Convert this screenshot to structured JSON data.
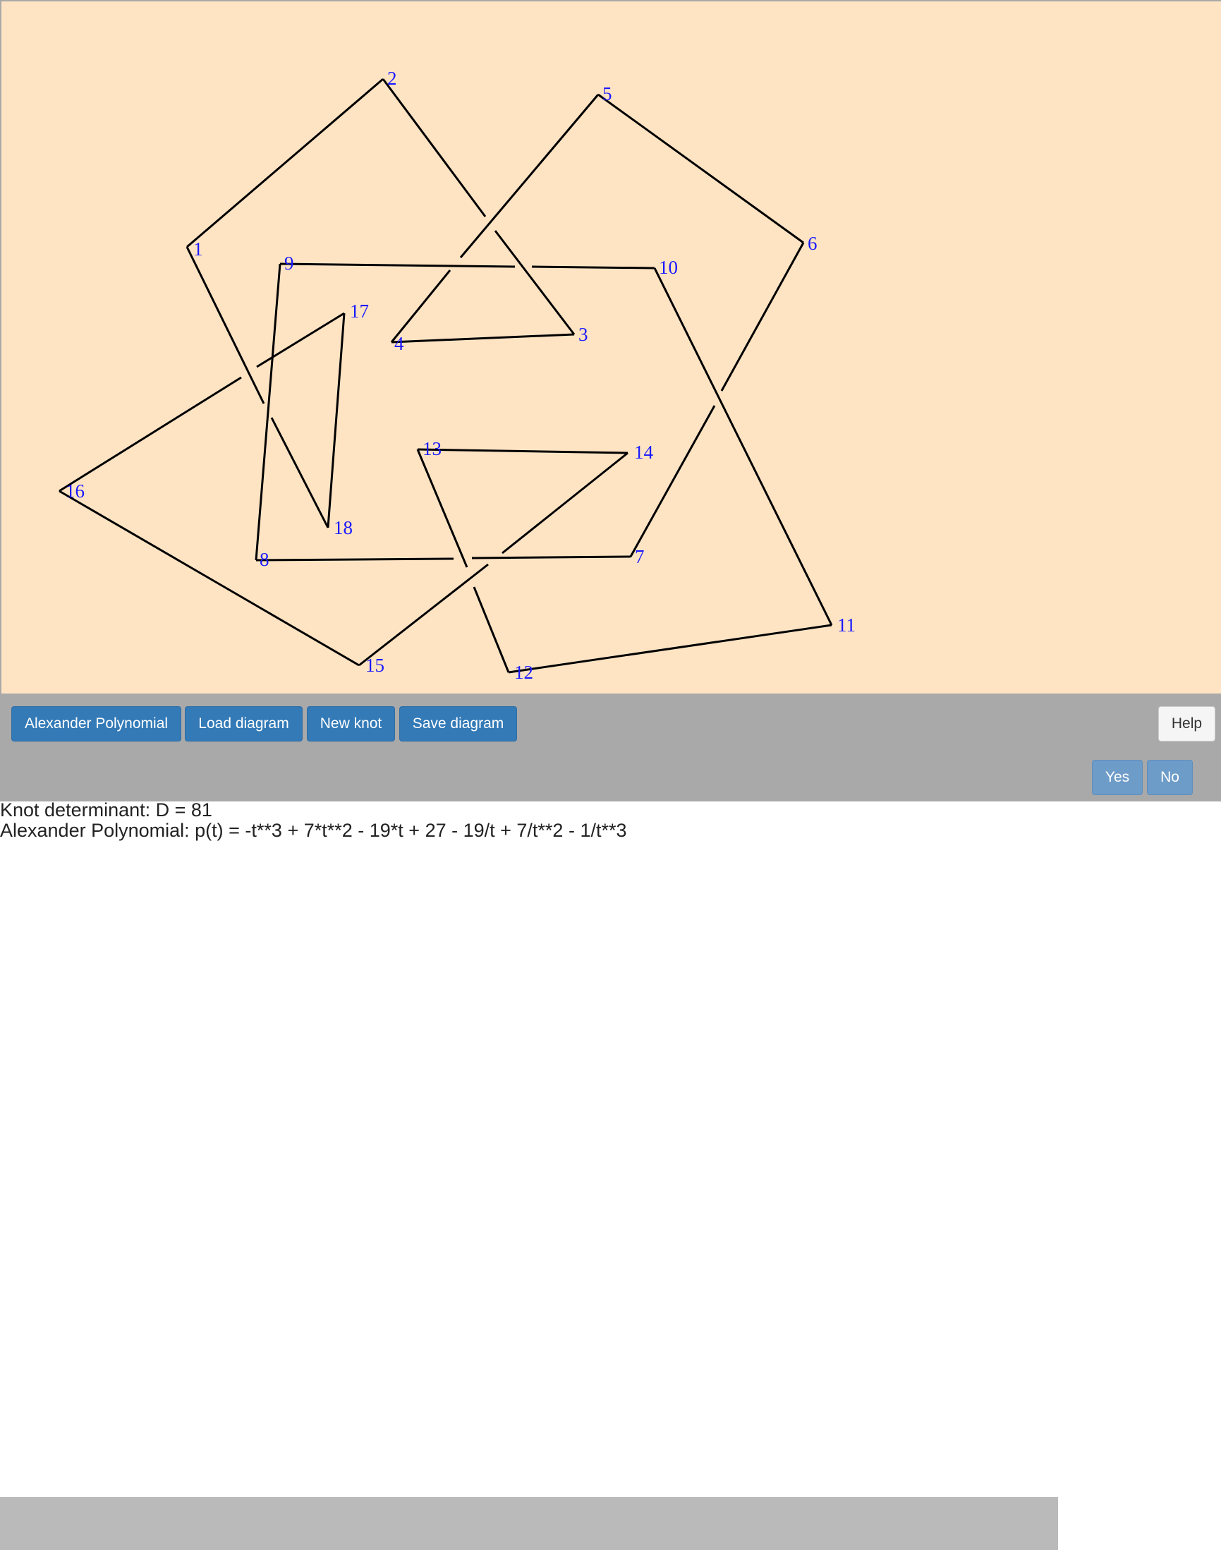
{
  "knot": {
    "vertex_labels": [
      "1",
      "2",
      "3",
      "4",
      "5",
      "6",
      "7",
      "8",
      "9",
      "10",
      "11",
      "12",
      "13",
      "14",
      "15",
      "16",
      "17",
      "18"
    ],
    "stroke_color": "#000000",
    "label_color": "#1a1aff",
    "background_color": "#ffe4c4"
  },
  "toolbar": {
    "alexander_label": "Alexander Polynomial",
    "load_label": "Load diagram",
    "new_label": "New knot",
    "save_label": "Save diagram",
    "help_label": "Help"
  },
  "confirm": {
    "message": "",
    "yes_label": "Yes",
    "no_label": "No"
  },
  "results": {
    "determinant": "Knot determinant: D = 81",
    "polynomial": "Alexander Polynomial: p(t) = -t**3 + 7*t**2 - 19*t + 27 - 19/t + 7/t**2 - 1/t**3"
  }
}
